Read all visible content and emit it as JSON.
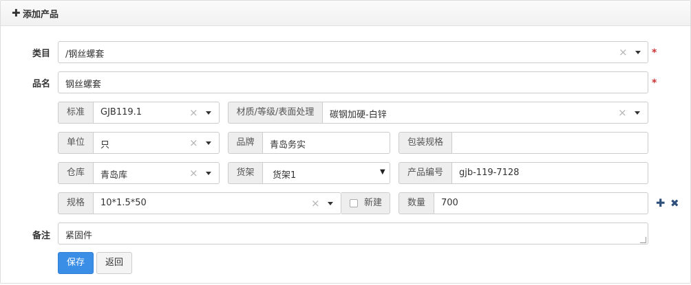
{
  "header": {
    "title": "添加产品",
    "add_icon": "plus-icon"
  },
  "form": {
    "category": {
      "label": "类目",
      "value": "/钢丝螺套",
      "required_mark": "*"
    },
    "name": {
      "label": "品名",
      "value": "钢丝螺套",
      "required_mark": "*"
    },
    "standard": {
      "label": "标准",
      "value": "GJB119.1"
    },
    "material": {
      "label": "材质/等级/表面处理",
      "value": "碳钢加硬-白锌"
    },
    "unit": {
      "label": "单位",
      "value": "只"
    },
    "brand": {
      "label": "品牌",
      "value": "青岛务实"
    },
    "packaging": {
      "label": "包装规格",
      "value": ""
    },
    "warehouse": {
      "label": "仓库",
      "value": "青岛库"
    },
    "shelf": {
      "label": "货架",
      "value": "货架1"
    },
    "product_code": {
      "label": "产品编号",
      "value": "gjb-119-7128"
    },
    "spec": {
      "label": "规格",
      "value": "10*1.5*50",
      "new_label": "新建"
    },
    "quantity": {
      "label": "数量",
      "value": "700"
    },
    "remark": {
      "label": "备注",
      "value": "紧固件"
    }
  },
  "glyphs": {
    "clear": "×",
    "plus": "✚",
    "remove": "✖",
    "native_caret": "▼"
  },
  "buttons": {
    "save": "保存",
    "back": "返回"
  },
  "colors": {
    "primary": "#3a8ee6",
    "required": "#cc3333",
    "icon": "#2c4f7c"
  }
}
